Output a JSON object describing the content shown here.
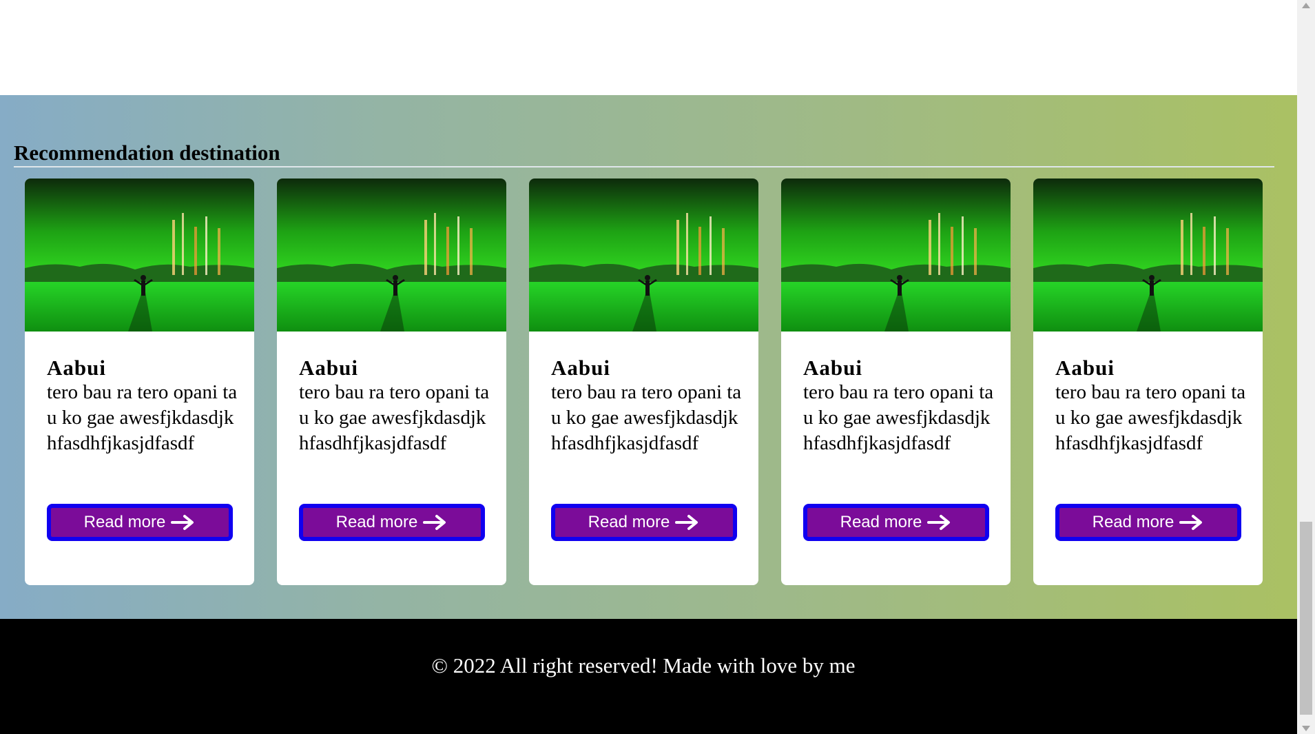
{
  "section": {
    "title": "Recommendation destination"
  },
  "cards": [
    {
      "title": "Aabui",
      "text": "tero bau ra tero opani tau ko gae awesfjkdasdjkhfasdhfjkasjdfasdf",
      "button_label": "Read more",
      "image_icon": "northern-lights-photo",
      "button_icon": "arrow-right-icon"
    },
    {
      "title": "Aabui",
      "text": "tero bau ra tero opani tau ko gae awesfjkdasdjkhfasdhfjkasjdfasdf",
      "button_label": "Read more",
      "image_icon": "northern-lights-photo",
      "button_icon": "arrow-right-icon"
    },
    {
      "title": "Aabui",
      "text": "tero bau ra tero opani tau ko gae awesfjkdasdjkhfasdhfjkasjdfasdf",
      "button_label": "Read more",
      "image_icon": "northern-lights-photo",
      "button_icon": "arrow-right-icon"
    },
    {
      "title": "Aabui",
      "text": "tero bau ra tero opani tau ko gae awesfjkdasdjkhfasdhfjkasjdfasdf",
      "button_label": "Read more",
      "image_icon": "northern-lights-photo",
      "button_icon": "arrow-right-icon"
    },
    {
      "title": "Aabui",
      "text": "tero bau ra tero opani tau ko gae awesfjkdasdjkhfasdhfjkasjdfasdf",
      "button_label": "Read more",
      "image_icon": "northern-lights-photo",
      "button_icon": "arrow-right-icon"
    }
  ],
  "footer": {
    "text": "© 2022 All right reserved! Made with love by me"
  },
  "colors": {
    "button_bg": "#7b0c99",
    "button_border": "#1000f0",
    "footer_bg": "#000000",
    "gradient_start": "#86acc6",
    "gradient_end": "#aac163"
  }
}
